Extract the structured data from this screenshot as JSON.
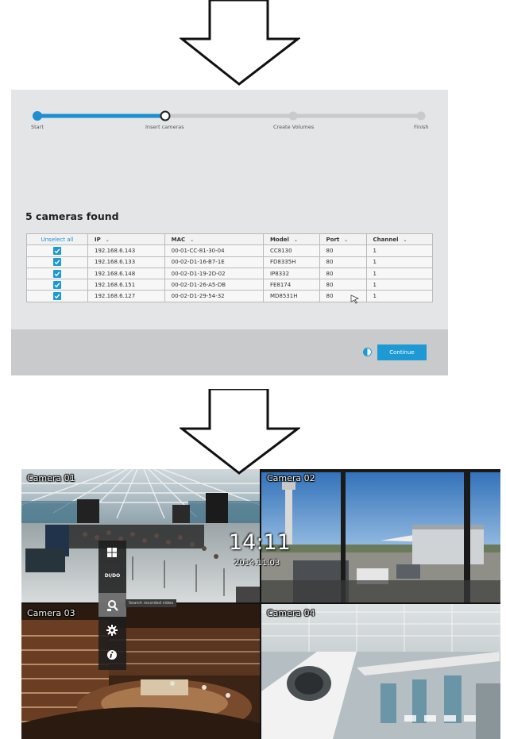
{
  "wizard": {
    "steps": [
      {
        "label": "Start",
        "state": "done"
      },
      {
        "label": "Insert cameras",
        "state": "current"
      },
      {
        "label": "Create Volumes",
        "state": "pending"
      },
      {
        "label": "Finish",
        "state": "pending"
      }
    ],
    "found_title": "5 cameras found",
    "table": {
      "unselect_all_label": "Unselect all",
      "columns": [
        "IP",
        "MAC",
        "Model",
        "Port",
        "Channel"
      ],
      "rows": [
        {
          "checked": true,
          "ip": "192.168.6.143",
          "mac": "00-01-CC-81-30-04",
          "model": "CC8130",
          "port": "80",
          "channel": "1"
        },
        {
          "checked": true,
          "ip": "192.168.6.133",
          "mac": "00-02-D1-16-B7-1E",
          "model": "FD8335H",
          "port": "80",
          "channel": "1"
        },
        {
          "checked": true,
          "ip": "192.168.6.148",
          "mac": "00-02-D1-19-2D-02",
          "model": "IP8332",
          "port": "80",
          "channel": "1"
        },
        {
          "checked": true,
          "ip": "192.168.6.151",
          "mac": "00-02-D1-26-A5-DB",
          "model": "FE8174",
          "port": "80",
          "channel": "1"
        },
        {
          "checked": true,
          "ip": "192.168.6.127",
          "mac": "00-02-D1-29-54-32",
          "model": "MD8531H",
          "port": "80",
          "channel": "1"
        }
      ]
    },
    "continue_label": "Continue",
    "accent_color": "#1d9ad6"
  },
  "liveview": {
    "cameras": [
      {
        "label": "Camera 01"
      },
      {
        "label": "Camera 02"
      },
      {
        "label": "Camera 03"
      },
      {
        "label": "Camera 04"
      }
    ],
    "time": "14:11",
    "date": "2014.11.03",
    "quickbar": {
      "items": [
        {
          "icon": "windows-icon"
        },
        {
          "icon": "dido-icon",
          "label": "DI/DO"
        },
        {
          "icon": "search-recording-icon",
          "tooltip": "Search recorded video"
        },
        {
          "icon": "gear-icon"
        },
        {
          "icon": "info-icon"
        }
      ]
    }
  }
}
